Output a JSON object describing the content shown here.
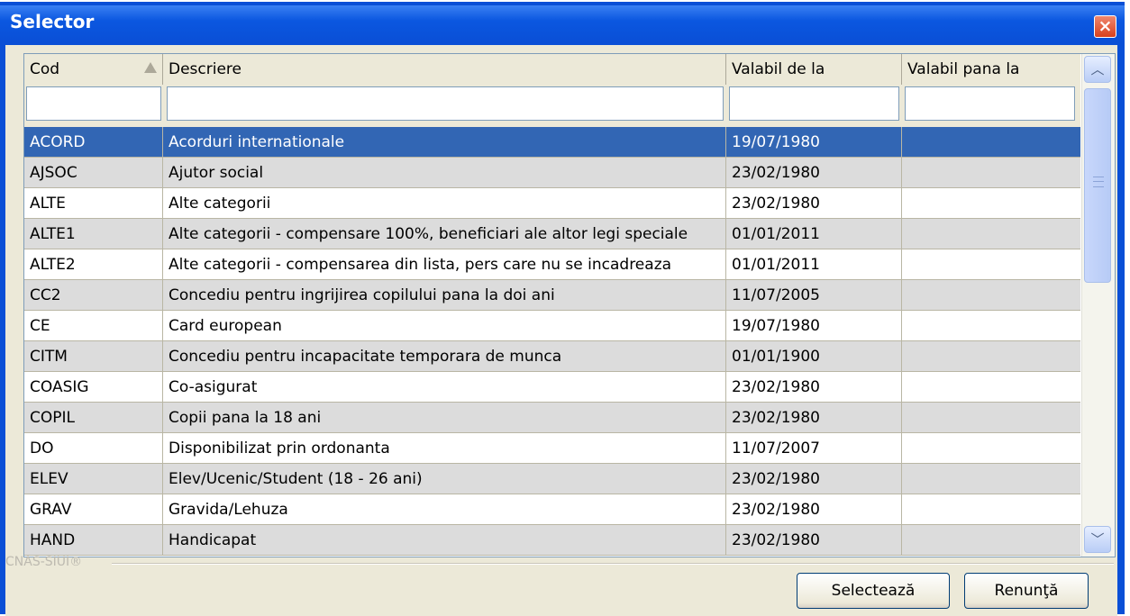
{
  "window": {
    "title": "Selector",
    "close_label": "×"
  },
  "columns": [
    {
      "label": "Cod"
    },
    {
      "label": "Descriere"
    },
    {
      "label": "Valabil de la"
    },
    {
      "label": "Valabil pana la"
    }
  ],
  "sort": {
    "column": "Cod",
    "direction": "ascending"
  },
  "filters": [
    "",
    "",
    "",
    ""
  ],
  "rows": [
    {
      "cod": "ACORD",
      "descriere": "Acorduri internationale",
      "de_la": "19/07/1980",
      "pana_la": ""
    },
    {
      "cod": "AJSOC",
      "descriere": "Ajutor social",
      "de_la": "23/02/1980",
      "pana_la": ""
    },
    {
      "cod": "ALTE",
      "descriere": "Alte categorii",
      "de_la": "23/02/1980",
      "pana_la": ""
    },
    {
      "cod": "ALTE1",
      "descriere": "Alte categorii - compensare 100%, beneficiari ale altor legi speciale",
      "de_la": "01/01/2011",
      "pana_la": ""
    },
    {
      "cod": "ALTE2",
      "descriere": "Alte categorii -  compensarea din lista, pers care nu se incadreaza",
      "de_la": "01/01/2011",
      "pana_la": ""
    },
    {
      "cod": "CC2",
      "descriere": "Concediu pentru ingrijirea copilului pana la doi ani",
      "de_la": "11/07/2005",
      "pana_la": ""
    },
    {
      "cod": "CE",
      "descriere": "Card european",
      "de_la": "19/07/1980",
      "pana_la": ""
    },
    {
      "cod": "CITM",
      "descriere": "Concediu pentru incapacitate temporara de munca",
      "de_la": "01/01/1900",
      "pana_la": ""
    },
    {
      "cod": "COASIG",
      "descriere": "Co-asigurat",
      "de_la": "23/02/1980",
      "pana_la": ""
    },
    {
      "cod": "COPIL",
      "descriere": "Copii pana la 18 ani",
      "de_la": "23/02/1980",
      "pana_la": ""
    },
    {
      "cod": "DO",
      "descriere": "Disponibilizat prin ordonanta",
      "de_la": "11/07/2007",
      "pana_la": ""
    },
    {
      "cod": "ELEV",
      "descriere": "Elev/Ucenic/Student (18 - 26 ani)",
      "de_la": "23/02/1980",
      "pana_la": ""
    },
    {
      "cod": "GRAV",
      "descriere": "Gravida/Lehuza",
      "de_la": "23/02/1980",
      "pana_la": ""
    },
    {
      "cod": "HAND",
      "descriere": "Handicapat",
      "de_la": "23/02/1980",
      "pana_la": ""
    }
  ],
  "selected_row": 0,
  "branding": "CNAS-SIUI®",
  "buttons": {
    "select": "Selectează",
    "cancel": "Renunţă"
  },
  "scrollbar": {
    "up_icon": "chevron-up-icon",
    "down_icon": "chevron-down-icon",
    "position": 0.0
  },
  "colors": {
    "selection": "#3266b4",
    "titlebar": "#0a4fd6",
    "alt_row": "#dcdcdc"
  }
}
